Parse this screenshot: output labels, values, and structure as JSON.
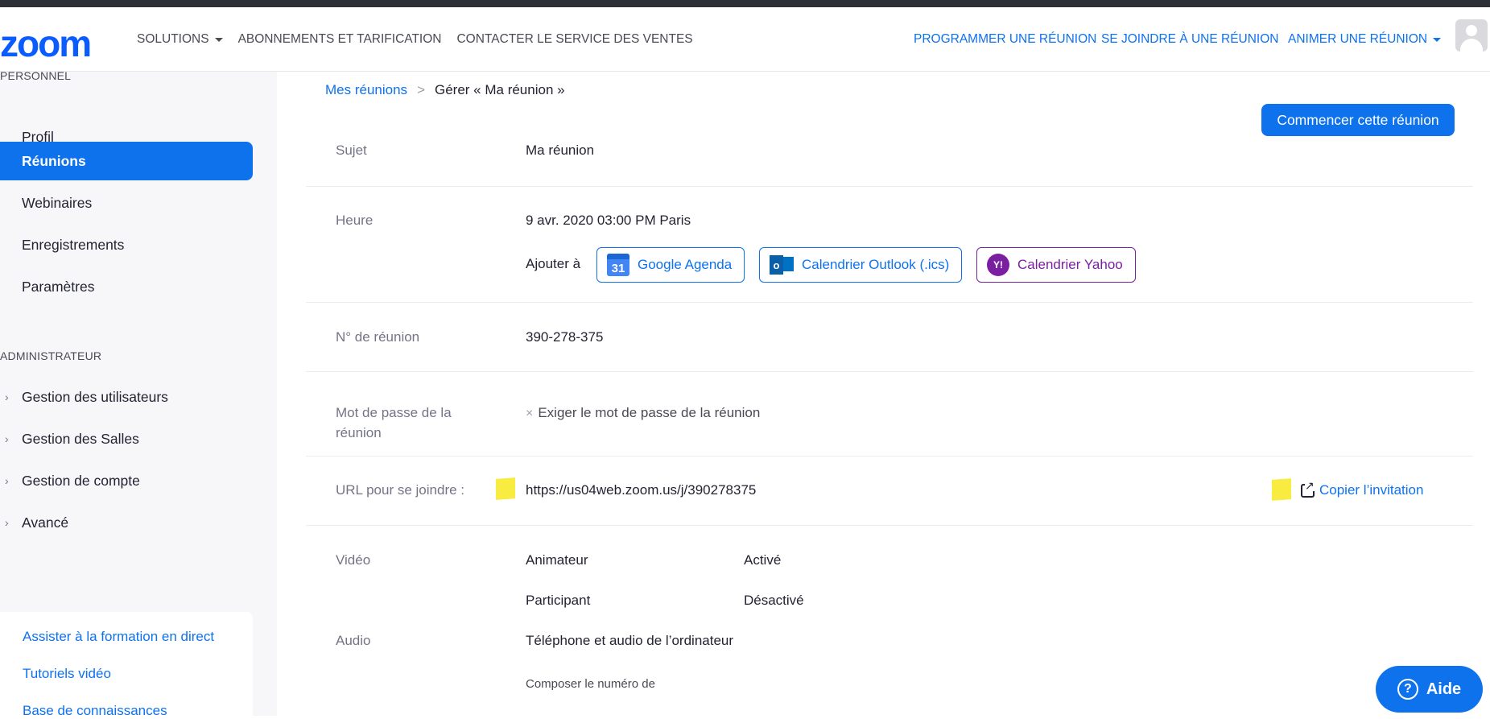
{
  "header": {
    "logo": "zoom",
    "nav_left": [
      "SOLUTIONS",
      "ABONNEMENTS ET TARIFICATION",
      "CONTACTER LE SERVICE DES VENTES"
    ],
    "nav_right": [
      "PROGRAMMER UNE RÉUNION",
      "SE JOINDRE À UNE RÉUNION",
      "ANIMER UNE RÉUNION"
    ]
  },
  "sidebar": {
    "section_personal": "PERSONNEL",
    "personal_items": [
      "Profil",
      "Réunions",
      "Webinaires",
      "Enregistrements",
      "Paramètres"
    ],
    "section_admin": "ADMINISTRATEUR",
    "admin_items": [
      "Gestion des utilisateurs",
      "Gestion des Salles",
      "Gestion de compte",
      "Avancé"
    ],
    "help_links": [
      "Assister à la formation en direct",
      "Tutoriels vidéo",
      "Base de connaissances"
    ]
  },
  "breadcrumb": {
    "link": "Mes réunions",
    "separator": ">",
    "current": "Gérer « Ma réunion »"
  },
  "start_button": "Commencer cette réunion",
  "meeting": {
    "subject_label": "Sujet",
    "subject_value": "Ma réunion",
    "time_label": "Heure",
    "time_value": "9 avr. 2020 03:00 PM Paris",
    "add_to_label": "Ajouter à",
    "calendars": {
      "google": "Google Agenda",
      "google_icon_text": "31",
      "outlook": "Calendrier Outlook (.ics)",
      "outlook_icon_text": "o",
      "yahoo": "Calendrier Yahoo",
      "yahoo_icon_text": "Y!"
    },
    "id_label": "N° de réunion",
    "id_value": "390-278-375",
    "password_label_1": "Mot de passe de la",
    "password_label_2": "réunion",
    "password_value": "Exiger le mot de passe de la réunion",
    "url_label": "URL pour se joindre :",
    "url_value": "https://us04web.zoom.us/j/390278375",
    "copy_invitation": "Copier l’invitation",
    "video_label": "Vidéo",
    "video_host_label": "Animateur",
    "video_host_value": "Activé",
    "video_participant_label": "Participant",
    "video_participant_value": "Désactivé",
    "audio_label": "Audio",
    "audio_value": "Téléphone et audio de l’ordinateur",
    "dial_label": "Composer le numéro de"
  },
  "help_button": {
    "icon_text": "?",
    "label": "Aide"
  }
}
